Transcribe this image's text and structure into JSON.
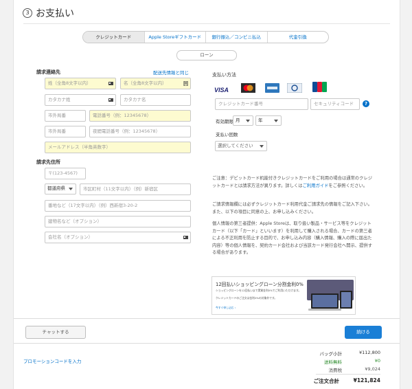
{
  "step": {
    "number": "3",
    "title": "お支払い"
  },
  "payment_tabs": [
    {
      "label": "クレジットカード",
      "active": true
    },
    {
      "label": "Apple Storeギフトカード",
      "active": false
    },
    {
      "label": "銀行振込／コンビニ払込",
      "active": false
    },
    {
      "label": "代金引換",
      "active": false
    }
  ],
  "loan_button": "ローン",
  "billing_contact": {
    "heading": "請求連絡先",
    "same_as_shipping_link": "配送先情報と同じ",
    "last_name_placeholder": "姓（全角8文字以内）",
    "first_name_placeholder": "名（全角8文字以内）",
    "last_kana_placeholder": "カタカナ姓",
    "first_kana_placeholder": "カタカナ名",
    "area_code_placeholder": "市外局番",
    "phone_placeholder": "電話番号（例：12345678）",
    "area_code2_placeholder": "市外局番",
    "night_phone_placeholder": "夜間電話番号（例：12345678）",
    "email_placeholder": "メールアドレス（半角英数字）"
  },
  "billing_address": {
    "heading": "請求先住所",
    "postal_placeholder": "〒(123-4567)",
    "prefecture_value": "都道府県",
    "city_placeholder": "市区町村（11文字以内）（例）新宿区",
    "street_placeholder": "番地など（17文字以内）（例）西新宿3-20-2",
    "building_placeholder": "建物名など（オプション）",
    "company_placeholder": "会社名（オプション）"
  },
  "payment_method": {
    "heading": "支払い方法",
    "card_brands": [
      "VISA",
      "Mastercard",
      "American Express",
      "Diners Club",
      "JCB"
    ],
    "card_number_placeholder": "クレジットカード番号",
    "security_code_placeholder": "セキュリティコード",
    "help_icon": "?",
    "expiry_label": "有効期限",
    "month_value": "月",
    "year_value": "年",
    "installments_label": "支払い回数",
    "installments_value": "選択してください"
  },
  "notes": {
    "note1_pre": "ご注意：デビットカード机能付きクレジットカードをご利用の場合は通常のクレジットカードとは請求方法が異ります。詳しくは",
    "note1_link": "ご利用ガイド",
    "note1_post": "をご参照ください。",
    "note2": "ご請求情報欄には必ずクレジットカード利用代金ご請求先の情報をご記入下さい。また、以下の項目に同意の上、お申し込みください。",
    "note3": "個人情報の第三者提供：Apple Storeは、取り扱い製品・サービス等をクレジットカード（以下「カード」といいます）を利用して購入される場合、カードの第三者による不正利用を防止する目的で、お申し込み内容（購入情報、購入の際に届出た内容）等の個人情報を、契約カード会社および当該カード発行会社へ開示、提供する場合があります。"
  },
  "banner": {
    "title": "12回払いショッピングローン分割金利0%",
    "line1": "ショッピングローンを12回払いまで実質金利0%でご利用いただけます。",
    "line2": "クレジットカードのご注文は金利0%の対象外です。",
    "link": "今すぐ申し込む ›"
  },
  "footer": {
    "chat_button": "チャットする",
    "continue_button": "続ける",
    "promo_link": "プロモーションコードを入力"
  },
  "summary": {
    "subtotal_label": "バッグ小計",
    "subtotal_value": "¥112,800",
    "shipping_label": "送料無料",
    "shipping_value": "¥0",
    "tax_label": "消費税",
    "tax_value": "¥9,024",
    "total_label": "ご注文合計",
    "total_value": "¥121,824"
  },
  "colors": {
    "accent": "#0070c9",
    "continue_button": "#1a7fd6",
    "field_highlight": "#fdfbd0",
    "free_shipping": "#2a8a2a"
  }
}
